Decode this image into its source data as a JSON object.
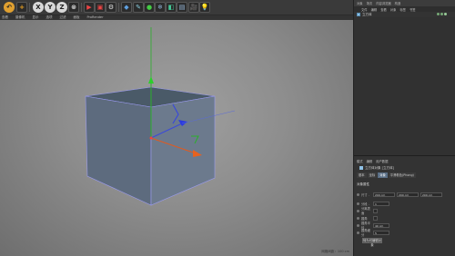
{
  "menu": {
    "items": [
      "查看",
      "摄像机",
      "显示",
      "选项",
      "过滤",
      "面板",
      "ProRender"
    ]
  },
  "viewport": {
    "status": "网格间距：100 cm"
  },
  "object_manager": {
    "tabs": [
      "对象",
      "场次",
      "内容浏览器",
      "构造"
    ],
    "toolbar": [
      "文件",
      "编辑",
      "查看",
      "对象",
      "标签",
      "书签"
    ],
    "object_name": "立方体"
  },
  "attributes": {
    "tabs": [
      "模式",
      "编辑",
      "用户数据"
    ],
    "title": "立方体对象 [立方体]",
    "subtabs": [
      "基本",
      "坐标",
      "对象",
      "平滑着色(Phong)"
    ],
    "section": "对象属性",
    "size_label": "尺寸 .",
    "size_values": [
      "200 cm",
      "200 cm",
      "200 cm"
    ],
    "params": [
      {
        "label": "分段 .",
        "value": "1"
      },
      {
        "label": "分离表面",
        "value": ""
      },
      {
        "label": "圆角",
        "value": ""
      },
      {
        "label": "圆角半径",
        "value": "40 cm"
      },
      {
        "label": "圆角细分",
        "value": "5"
      }
    ],
    "button": "转为可编辑对象"
  }
}
